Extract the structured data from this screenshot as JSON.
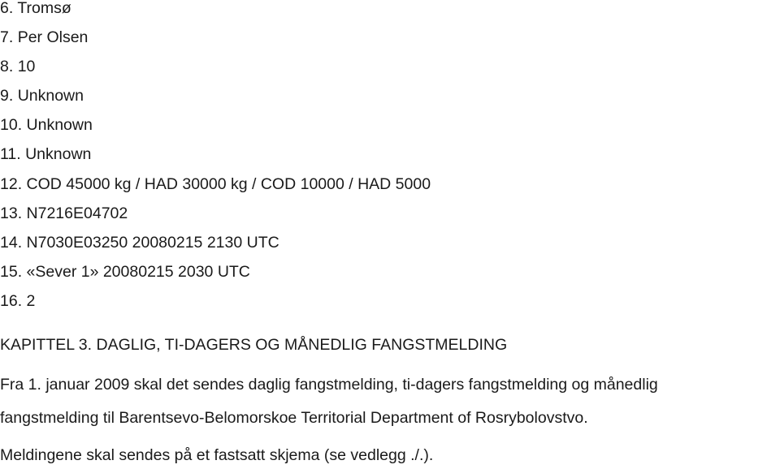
{
  "list_items": [
    {
      "number": "6.",
      "text": "Tromsø"
    },
    {
      "number": "7.",
      "text": "Per Olsen"
    },
    {
      "number": "8.",
      "text": "10"
    },
    {
      "number": "9.",
      "text": "Unknown"
    },
    {
      "number": "10.",
      "text": "Unknown"
    },
    {
      "number": "11.",
      "text": "Unknown"
    },
    {
      "number": "12.",
      "text": "COD 45000 kg / HAD 30000 kg / COD 10000 / HAD 5000"
    },
    {
      "number": "13.",
      "text": "N7216E04702"
    },
    {
      "number": "14.",
      "text": "N7030E03250 20080215 2130 UTC"
    },
    {
      "number": "15.",
      "text": "«Sever 1» 20080215 2030 UTC"
    },
    {
      "number": "16.",
      "text": "2"
    }
  ],
  "chapter_heading": "KAPITTEL 3. DAGLIG, TI-DAGERS OG MÅNEDLIG FANGSTMELDING",
  "paragraphs": [
    {
      "lines": [
        "Fra 1. januar 2009 skal det sendes daglig fangstmelding, ti-dagers fangstmelding og månedlig",
        "fangstmelding til Barentsevo-Belomorskoe Territorial Department of Rosrybolovstvo."
      ]
    },
    {
      "lines": [
        "Meldingene skal sendes på et fastsatt skjema (se vedlegg ./.)."
      ]
    }
  ]
}
